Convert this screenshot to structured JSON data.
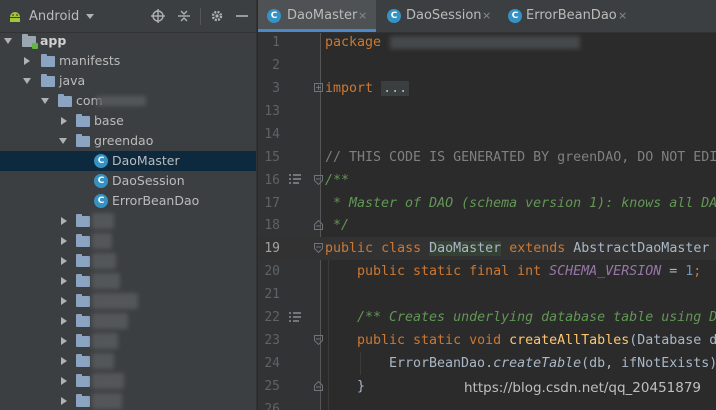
{
  "panel": {
    "view_label": "Android",
    "tree": [
      {
        "label": "app"
      },
      {
        "label": "manifests"
      },
      {
        "label": "java"
      },
      {
        "label": "com"
      },
      {
        "label": "base"
      },
      {
        "label": "greendao"
      },
      {
        "label": "DaoMaster",
        "icon": "C"
      },
      {
        "label": "DaoSession",
        "icon": "C"
      },
      {
        "label": "ErrorBeanDao",
        "icon": "C"
      }
    ],
    "icons": {
      "locate": "crosshair-icon",
      "collapse": "collapse-all-icon",
      "settings": "gear-icon",
      "hide": "minimize-icon"
    }
  },
  "tabs": [
    {
      "label": "DaoMaster",
      "close": "×"
    },
    {
      "label": "DaoSession",
      "close": "×"
    },
    {
      "label": "ErrorBeanDao",
      "close": "×"
    }
  ],
  "editor": {
    "line_numbers": [
      "1",
      "2",
      "3",
      "13",
      "14",
      "15",
      "16",
      "17",
      "18",
      "19",
      "20",
      "21",
      "22",
      "23",
      "24",
      "25",
      "26"
    ],
    "current_line": "19",
    "code": {
      "l1_kw": "package",
      "l3_kw": "import",
      "l3_folded": "...",
      "l15": "// THIS CODE IS GENERATED BY greenDAO, DO NOT EDI",
      "l16": "/**",
      "l17": " * Master of DAO (schema version 1): knows all DA",
      "l18": " */",
      "l19_kw1": "public",
      "l19_kw2": "class",
      "l19_name": "DaoMaster",
      "l19_kw3": "extends",
      "l19_super": "AbstractDaoMaster",
      "l20_kw": "public static final int",
      "l20_const": "SCHEMA_VERSION",
      "l20_eq": " = ",
      "l20_num": "1",
      "l20_semi": ";",
      "l22": "/** Creates underlying database table using D",
      "l23_kw": "public static void",
      "l23_fn": "createAllTables",
      "l23_rest": "(Database d",
      "l24_cls": "ErrorBeanDao.",
      "l24_fn": "createTable",
      "l24_rest": "(db, ifNotExists)",
      "l25": "}"
    }
  },
  "watermark": "https://blog.csdn.net/qq_20451879",
  "colors": {
    "accent": "#4a88c7",
    "selection": "#0d293e",
    "keyword": "#cc7832",
    "comment": "#808080",
    "doc_comment": "#629755",
    "constant": "#9876aa",
    "function": "#ffc66d"
  }
}
